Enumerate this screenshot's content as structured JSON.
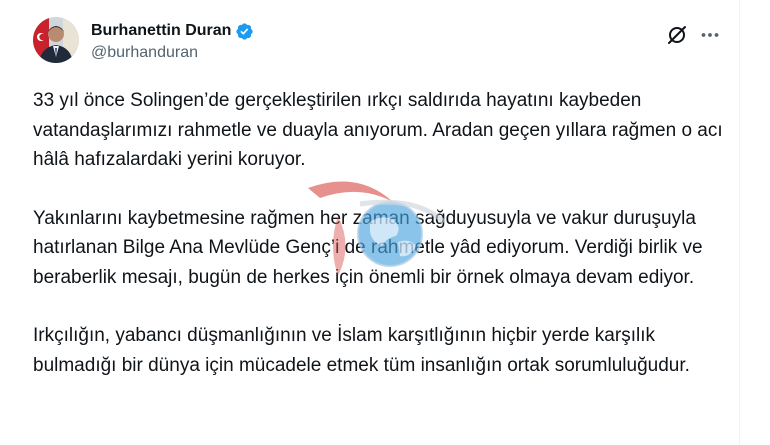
{
  "author": {
    "display_name": "Burhanettin Duran",
    "handle": "@burhanduran",
    "verified": true
  },
  "actions": {
    "grok_icon": "grok-slash-circle-icon",
    "more_icon": "more-horizontal-icon"
  },
  "tweet": {
    "paragraphs": [
      "33 yıl önce Solingen’de gerçekleştirilen ırkçı saldırıda hayatını kaybeden vatandaşlarımızı rahmetle ve duayla anıyorum. Aradan geçen yıllara rağmen o acı hâlâ hafızalardaki yerini koruyor.",
      "Yakınlarını kaybetmesine rağmen her zaman sağduyusuyla ve vakur duruşuyla hatırlanan Bilge Ana Mevlüde Genç’i de rahmetle yâd ediyorum. Verdiği birlik ve beraberlik mesajı, bugün de herkes için önemli bir örnek olmaya devam ediyor.",
      "Irkçılığın, yabancı düşmanlığının ve İslam karşıtlığının hiçbir yerde karşılık bulmadığı bir dünya için mücadele etmek tüm insanlığın ortak sorumluluğudur."
    ]
  },
  "colors": {
    "text_primary": "#0f1419",
    "text_secondary": "#536471",
    "verified_blue": "#1d9bf0"
  }
}
